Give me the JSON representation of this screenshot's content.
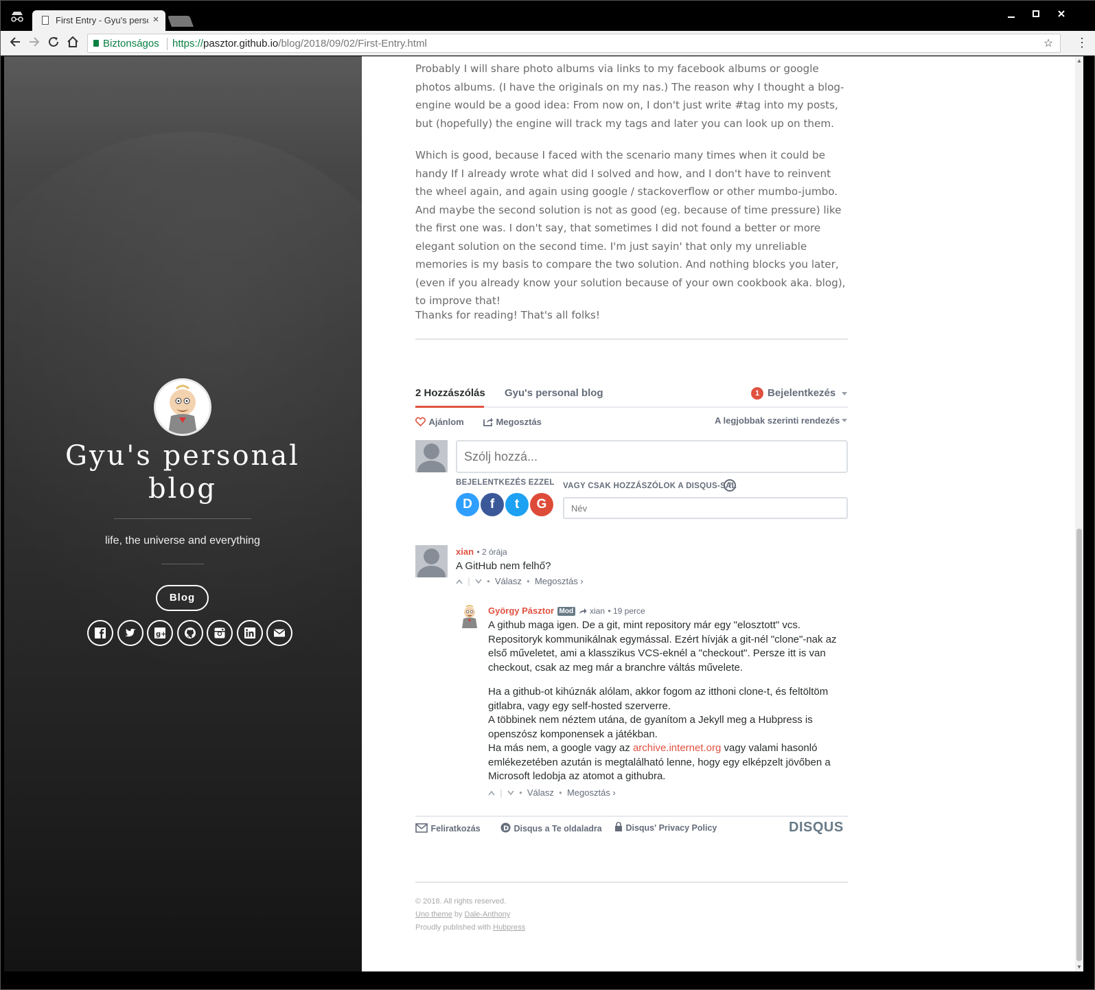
{
  "browser": {
    "tab_title": "First Entry - Gyu's personal blog",
    "tab_close": "×",
    "secure_label": "Biztonságos",
    "url_scheme": "https://",
    "url_host": "pasztor.github.io",
    "url_path": "/blog/2018/09/02/First-Entry.html"
  },
  "sidebar": {
    "title": "Gyu's personal blog",
    "tagline": "life, the universe and everything",
    "blog_button": "Blog",
    "social_icons": [
      "facebook-icon",
      "twitter-icon",
      "google-plus-icon",
      "github-icon",
      "instagram-icon",
      "linkedin-icon",
      "email-icon"
    ]
  },
  "article": {
    "paragraphs": [
      "Probably I will share photo albums via links to my facebook albums or google photos albums. (I have the originals on my nas.) The reason why I thought a blog-engine would be a good idea: From now on, I don't just write #tag into my posts, but (hopefully) the engine will track my tags and later you can look up on them.",
      "Which is good, because I faced with the scenario many times when it could be handy If I already wrote what did I solved and how, and I don't have to reinvent the wheel again, and again using google / stackoverflow or other mumbo-jumbo. And maybe the second solution is not as good (eg. because of time pressure) like the first one was. I don't say, that sometimes I did not found a better or more elegant solution on the second time. I'm just sayin' that only my unreliable memories is my basis to compare the two solution. And nothing blocks you later, (even if you already know your solution because of your own cookbook aka. blog), to improve that!",
      "Thanks for reading! That's all folks!"
    ]
  },
  "disqus": {
    "tab_comments": "2 Hozzászólás",
    "tab_community": "Gyu's personal blog",
    "login_badge": "1",
    "login_label": "Bejelentkezés",
    "recommend": "Ajánlom",
    "share": "Megosztás",
    "sort": "A legjobbak szerinti rendezés",
    "comment_placeholder": "Szólj hozzá...",
    "login_with": "BEJELENTKEZÉS EZZEL",
    "or_guest": "VAGY CSAK HOZZÁSZÓLOK A DISQUS-SAL",
    "help": "?",
    "name_placeholder": "Név",
    "social_logins": {
      "disqus": "D",
      "facebook": "f",
      "twitter": "t",
      "google": "G"
    },
    "comments": [
      {
        "author": "xian",
        "time": "• 2 órája",
        "text": "A GitHub nem felhő?",
        "reply": "Válasz",
        "share": "Megosztás ›"
      },
      {
        "author": "György Pásztor",
        "badge": "Mod",
        "reply_to": "xian",
        "time": "• 19 perce",
        "p1": "A github maga igen. De a git, mint repository már egy \"elosztott\" vcs. Repositoryk kommunikálnak egymással. Ezért hívják a git-nél \"clone\"-nak az első műveletet, ami a klasszikus VCS-eknél a \"checkout\". Persze itt is van checkout, csak az meg már a branchre váltás művelete.",
        "p2a": "Ha a github-ot kihúznák alólam, akkor fogom az itthoni clone-t, és feltöltöm gitlabra, vagy egy self-hosted szerverre.",
        "p2b": "A többinek nem néztem utána, de gyanítom a Jekyll meg a Hubpress is openszósz komponensek a játékban.",
        "p2c_pre": "Ha más nem, a google vagy az ",
        "p2c_link": "archive.internet.org",
        "p2c_post": " vagy valami hasonló emlékezetében azután is megtalálható lenne, hogy egy elképzelt jövőben a Microsoft ledobja az atomot a githubra.",
        "reply": "Válasz",
        "share": "Megosztás ›"
      }
    ],
    "footer": {
      "subscribe": "Feliratkozás",
      "add_disqus": "Disqus a Te oldaladra",
      "privacy": "Disqus' Privacy Policy",
      "logo": "DISQUS"
    }
  },
  "page_footer": {
    "copyright": "© 2018. All rights reserved.",
    "theme_link": "Uno theme",
    "by": " by ",
    "author_link": "Dale-Anthony",
    "published": "Proudly published with ",
    "engine_link": "Hubpress"
  },
  "colors": {
    "accent": "#e0513f",
    "secure_green": "#0b8043",
    "disqus_text": "#2a2e2e",
    "disqus_muted": "#656c7a",
    "facebook": "#3b5998",
    "twitter": "#1da1f2",
    "google": "#dd4b39",
    "disqus_blue": "#2e9fff"
  }
}
